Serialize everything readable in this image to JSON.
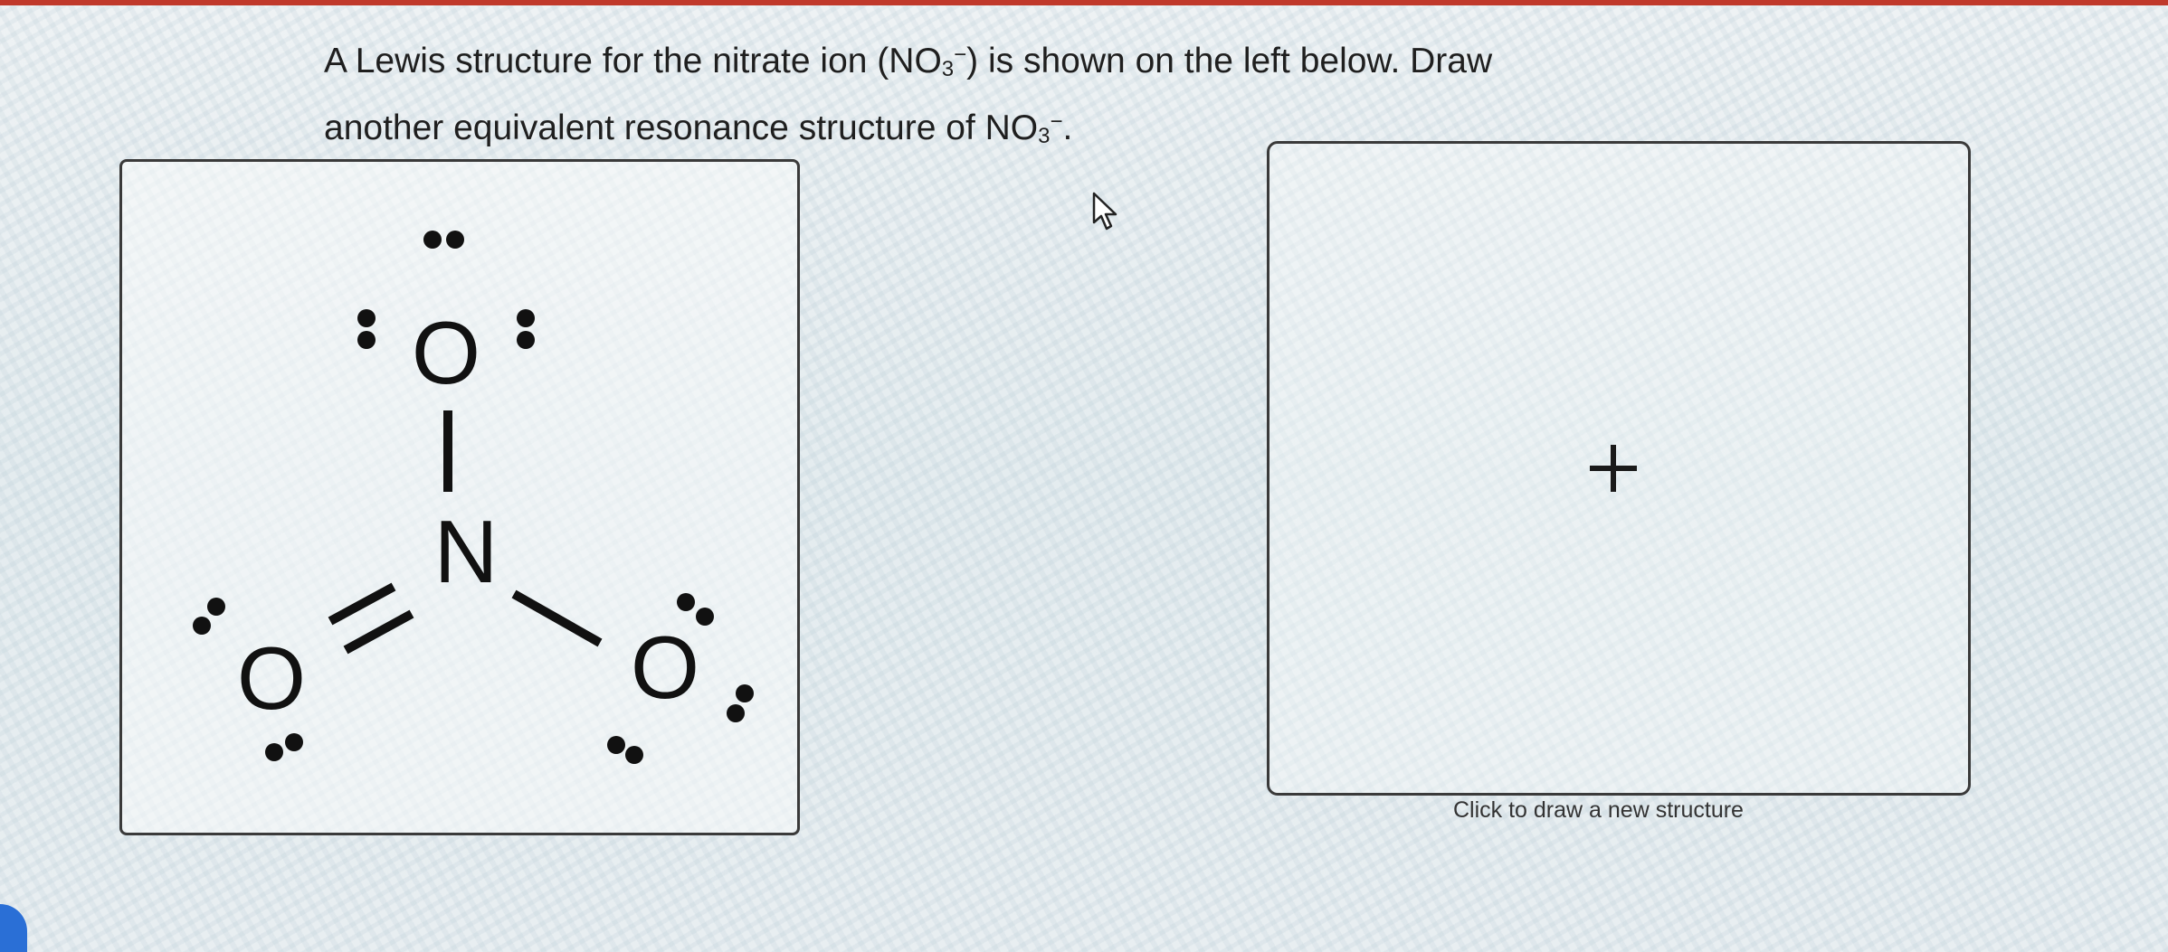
{
  "question": {
    "line1_prefix": "A Lewis structure for the nitrate ion (NO",
    "line1_sub": "3",
    "line1_sup": "−",
    "line1_suffix": ") is shown on the left below. Draw",
    "line2_prefix": "another equivalent resonance structure of NO",
    "line2_sub": "3",
    "line2_sup": "−",
    "line2_suffix": "."
  },
  "given_structure": {
    "atoms": {
      "top_oxygen": "O",
      "nitrogen": "N",
      "left_oxygen": "O",
      "right_oxygen": "O"
    },
    "bonds": [
      "single N–O (top)",
      "double N=O (left)",
      "single N–O (right)"
    ]
  },
  "draw_panel": {
    "caption": "Click to draw a new structure",
    "add_icon": "plus-icon"
  },
  "cursor_icon": "arrow-cursor-icon",
  "colors": {
    "accent_strip": "#c0392b",
    "panel_border": "#3a3a3a",
    "ink": "#1a1a1a"
  }
}
